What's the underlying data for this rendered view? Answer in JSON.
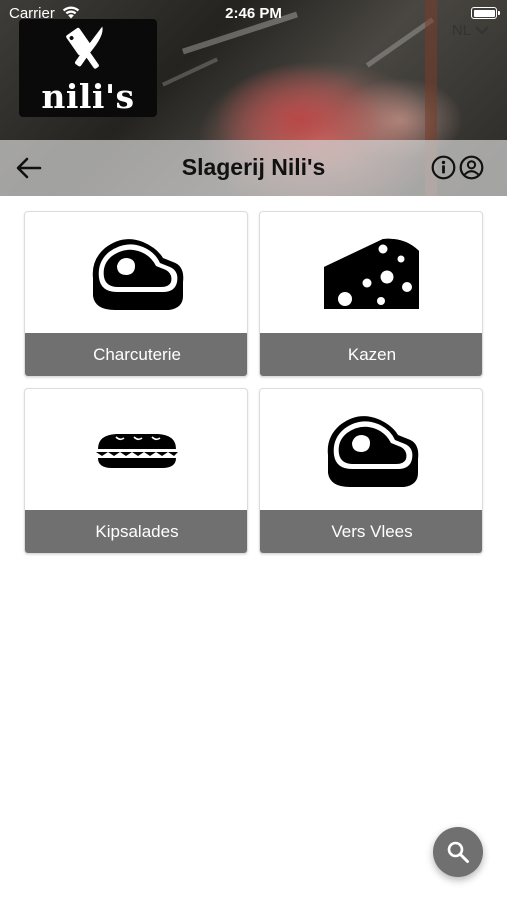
{
  "status_bar": {
    "carrier": "Carrier",
    "time": "2:46 PM"
  },
  "header": {
    "logo_text": "nili's",
    "language": "NL",
    "title": "Slagerij Nili's"
  },
  "categories": [
    {
      "label": "Charcuterie",
      "icon": "steak-icon"
    },
    {
      "label": "Kazen",
      "icon": "cheese-icon"
    },
    {
      "label": "Kipsalades",
      "icon": "sandwich-icon"
    },
    {
      "label": "Vers Vlees",
      "icon": "steak-icon"
    }
  ],
  "colors": {
    "nav_bar": "#d2d2d2",
    "card_label_bg": "#707070",
    "fab_bg": "#707070",
    "icon": "#000000"
  }
}
